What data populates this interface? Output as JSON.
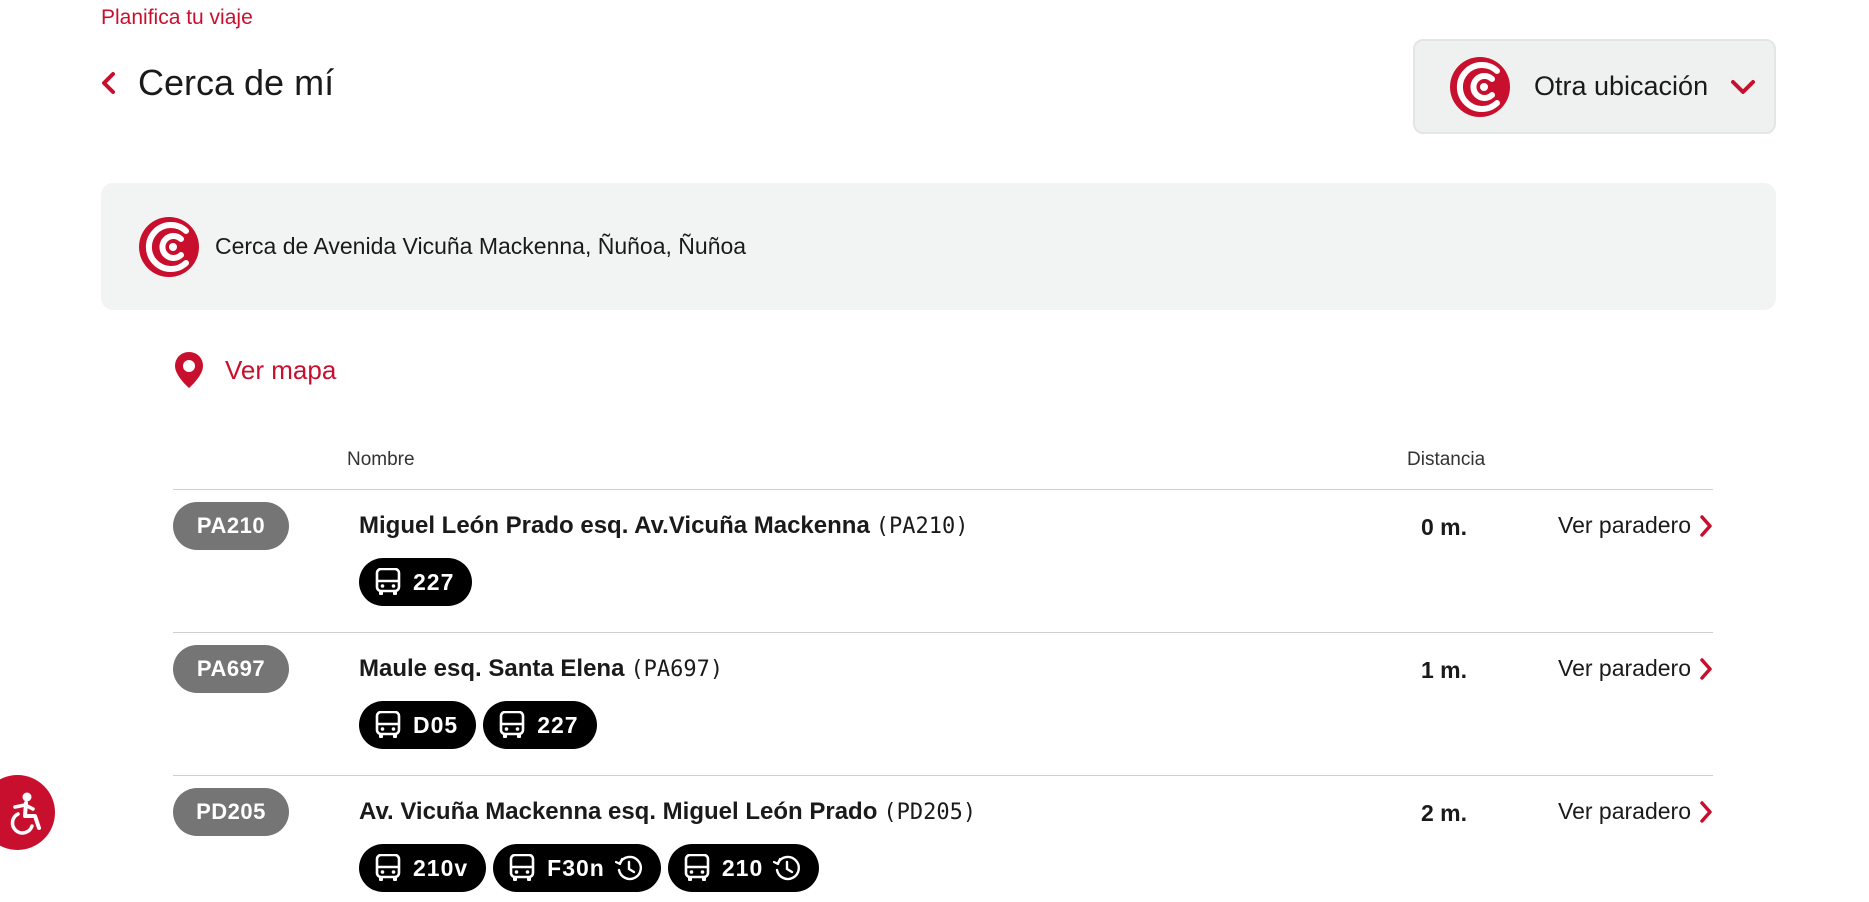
{
  "breadcrumb": "Planifica tu viaje",
  "header": {
    "title": "Cerca de mí"
  },
  "location_selector": {
    "label": "Otra ubicación"
  },
  "location": {
    "text": "Cerca de Avenida Vicuña Mackenna, Ñuñoa, Ñuñoa"
  },
  "map_link": "Ver mapa",
  "table": {
    "col_name": "Nombre",
    "col_distance": "Distancia",
    "rows": [
      {
        "code": "PA210",
        "name": "Miguel León Prado esq. Av.Vicuña Mackenna",
        "code_paren": "(PA210)",
        "distance": "0 m.",
        "link": "Ver paradero",
        "routes": [
          {
            "number": "227",
            "scheduled": false
          }
        ]
      },
      {
        "code": "PA697",
        "name": "Maule esq. Santa Elena",
        "code_paren": "(PA697)",
        "distance": "1 m.",
        "link": "Ver paradero",
        "routes": [
          {
            "number": "D05",
            "scheduled": false
          },
          {
            "number": "227",
            "scheduled": false
          }
        ]
      },
      {
        "code": "PD205",
        "name": "Av. Vicuña Mackenna esq. Miguel León Prado",
        "code_paren": "(PD205)",
        "distance": "2 m.",
        "link": "Ver paradero",
        "routes": [
          {
            "number": "210v",
            "scheduled": false
          },
          {
            "number": "F30n",
            "scheduled": true
          },
          {
            "number": "210",
            "scheduled": true
          }
        ]
      }
    ]
  },
  "colors": {
    "brand": "#c8102e",
    "code_badge": "#757575",
    "route_pill": "#000000",
    "panel": "#f2f3f3"
  },
  "icons": [
    "chevron-left-icon",
    "brand-logo-icon",
    "chevron-down-icon",
    "map-pin-icon",
    "bus-icon",
    "clock-icon",
    "chevron-right-icon",
    "accessibility-icon"
  ]
}
